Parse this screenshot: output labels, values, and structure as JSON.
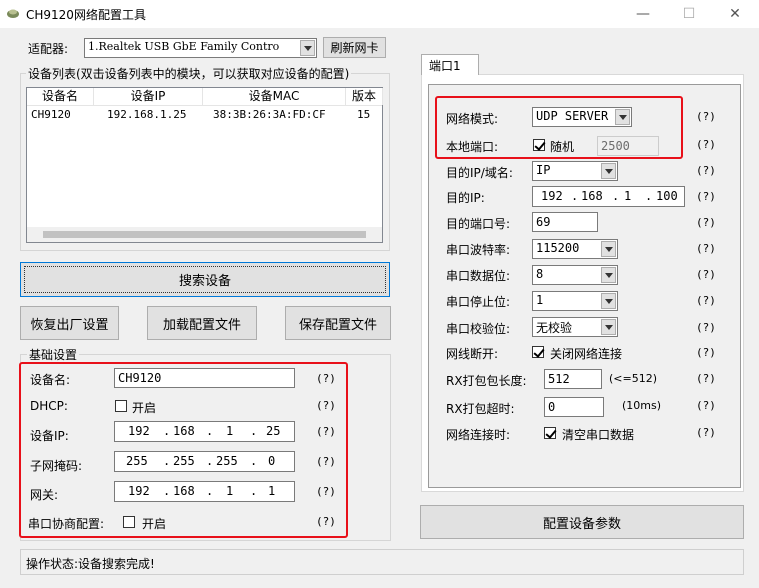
{
  "window": {
    "title": "CH9120网络配置工具",
    "minimize_glyph": "—",
    "maximize_glyph": "☐",
    "close_glyph": "✕"
  },
  "adapter": {
    "label": "适配器:",
    "value": "1.Realtek USB GbE Family Contro",
    "refresh_label": "刷新网卡"
  },
  "device_list": {
    "group_title": "设备列表(双击设备列表中的模块，可以获取对应设备的配置)",
    "columns": [
      "设备名",
      "设备IP",
      "设备MAC",
      "版本"
    ],
    "rows": [
      {
        "name": "CH9120",
        "ip": "192.168.1.25",
        "mac": "38:3B:26:3A:FD:CF",
        "version": "15"
      }
    ]
  },
  "buttons": {
    "search": "搜索设备",
    "factory_reset": "恢复出厂设置",
    "load_config": "加载配置文件",
    "save_config": "保存配置文件",
    "apply_params": "配置设备参数"
  },
  "basic": {
    "group_title": "基础设置",
    "device_name_label": "设备名:",
    "device_name_value": "CH9120",
    "dhcp_label": "DHCP:",
    "dhcp_option": "开启",
    "ip_label": "设备IP:",
    "ip_octets": [
      "192",
      "168",
      "1",
      "25"
    ],
    "mask_label": "子网掩码:",
    "mask_octets": [
      "255",
      "255",
      "255",
      "0"
    ],
    "gateway_label": "网关:",
    "gateway_octets": [
      "192",
      "168",
      "1",
      "1"
    ],
    "serial_neg_label": "串口协商配置:",
    "serial_neg_option": "开启",
    "help": "(?)"
  },
  "port": {
    "tab_label": "端口1",
    "net_mode_label": "网络模式:",
    "net_mode_value": "UDP SERVER",
    "local_port_label": "本地端口:",
    "random_label": "随机",
    "local_port_value": "2500",
    "dest_type_label": "目的IP/域名:",
    "dest_type_value": "IP",
    "dest_ip_label": "目的IP:",
    "dest_ip_octets": [
      "192",
      "168",
      "1",
      "100"
    ],
    "dest_port_label": "目的端口号:",
    "dest_port_value": "69",
    "baud_label": "串口波特率:",
    "baud_value": "115200",
    "data_bits_label": "串口数据位:",
    "data_bits_value": "8",
    "stop_bits_label": "串口停止位:",
    "stop_bits_value": "1",
    "parity_label": "串口校验位:",
    "parity_value": "无校验",
    "disconnect_label": "网线断开:",
    "disconnect_option": "关闭网络连接",
    "rx_len_label": "RX打包包长度:",
    "rx_len_value": "512",
    "rx_len_hint": "(<=512)",
    "rx_timeout_label": "RX打包超时:",
    "rx_timeout_value": "0",
    "rx_timeout_hint": "(10ms)",
    "connect_label": "网络连接时:",
    "connect_option": "清空串口数据",
    "help": "(?)"
  },
  "status": {
    "text": "操作状态:设备搜索完成!"
  },
  "colors": {
    "highlight_box": "#e8101a",
    "window_bg": "#f0f0f0",
    "button_bg": "#e1e1e1"
  }
}
